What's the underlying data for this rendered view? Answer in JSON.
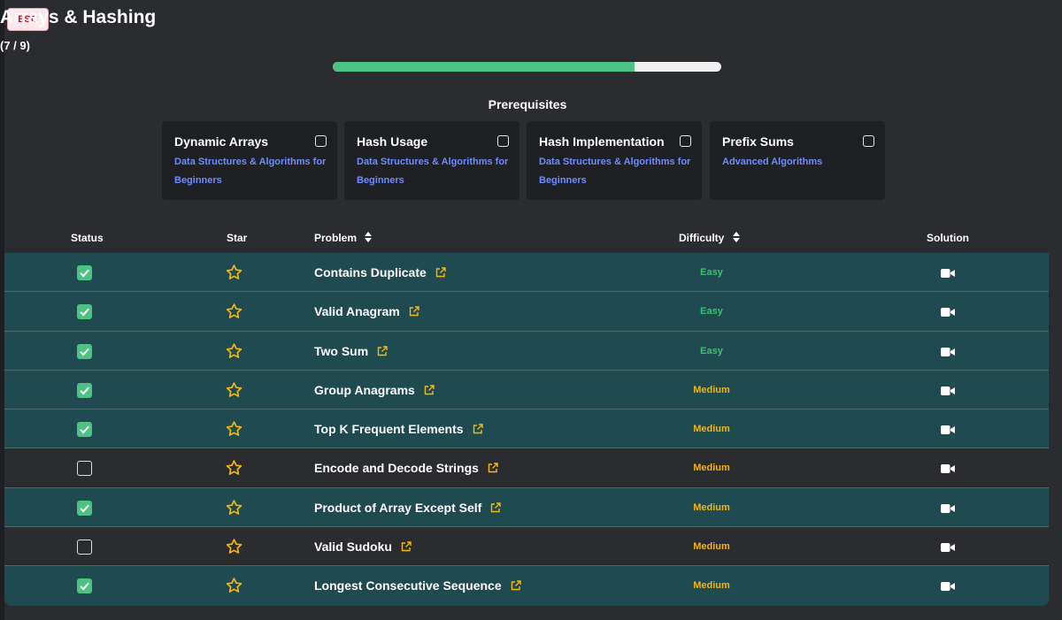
{
  "esc_label": "ESC",
  "title": "Arrays & Hashing",
  "progress": {
    "text": "(7 / 9)",
    "completed": 7,
    "total": 9
  },
  "prerequisites": {
    "title": "Prerequisites",
    "items": [
      {
        "name": "Dynamic Arrays",
        "course": "Data Structures & Algorithms for Beginners",
        "checked": false
      },
      {
        "name": "Hash Usage",
        "course": "Data Structures & Algorithms for Beginners",
        "checked": false
      },
      {
        "name": "Hash Implementation",
        "course": "Data Structures & Algorithms for Beginners",
        "checked": false
      },
      {
        "name": "Prefix Sums",
        "course": "Advanced Algorithms",
        "checked": false
      }
    ]
  },
  "table": {
    "headers": {
      "status": "Status",
      "star": "Star",
      "problem": "Problem",
      "difficulty": "Difficulty",
      "solution": "Solution"
    },
    "rows": [
      {
        "problem": "Contains Duplicate",
        "difficulty": "Easy",
        "done": true
      },
      {
        "problem": "Valid Anagram",
        "difficulty": "Easy",
        "done": true
      },
      {
        "problem": "Two Sum",
        "difficulty": "Easy",
        "done": true
      },
      {
        "problem": "Group Anagrams",
        "difficulty": "Medium",
        "done": true
      },
      {
        "problem": "Top K Frequent Elements",
        "difficulty": "Medium",
        "done": true
      },
      {
        "problem": "Encode and Decode Strings",
        "difficulty": "Medium",
        "done": false
      },
      {
        "problem": "Product of Array Except Self",
        "difficulty": "Medium",
        "done": true
      },
      {
        "problem": "Valid Sudoku",
        "difficulty": "Medium",
        "done": false
      },
      {
        "problem": "Longest Consecutive Sequence",
        "difficulty": "Medium",
        "done": true
      }
    ]
  },
  "icons": {
    "star": "star-outline-icon",
    "external_link": "external-link-icon",
    "solution": "video-camera-icon",
    "sort": "sort-icon",
    "checkbox": "checkbox-icon"
  },
  "colors": {
    "accent_green": "#4cc385",
    "done_row": "#1e4a50",
    "easy": "#3fbf73",
    "medium": "#f6b40a",
    "course_link": "#6e8cff",
    "star": "#f5b90b"
  }
}
